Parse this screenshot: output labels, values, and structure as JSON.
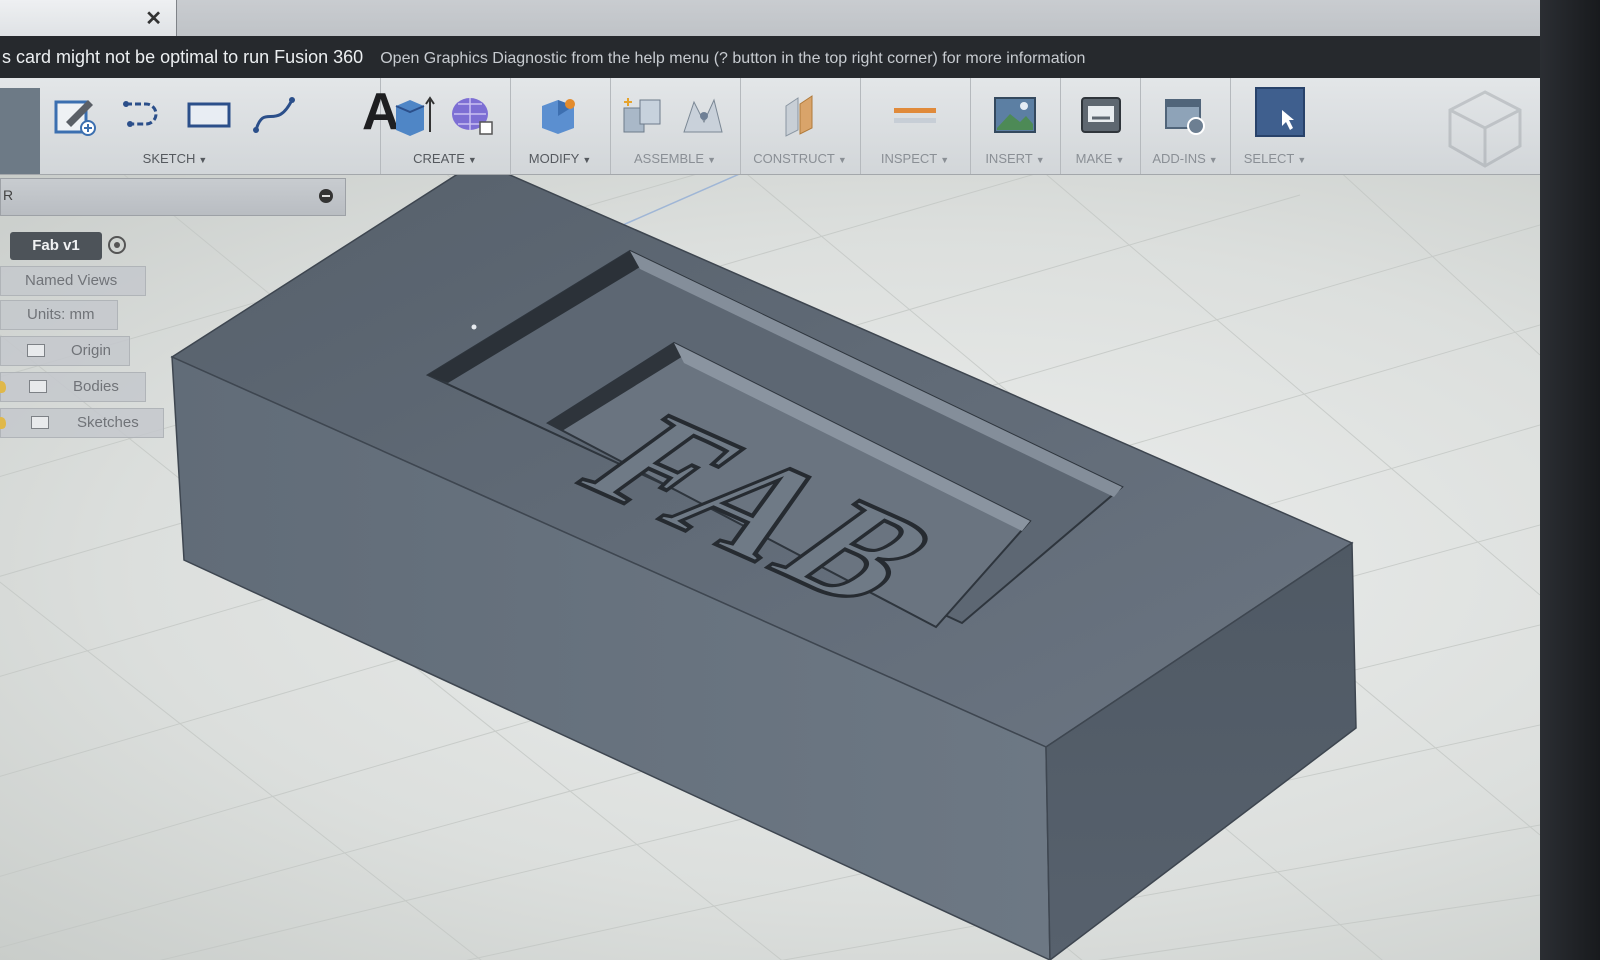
{
  "document_tab": {
    "close_glyph": "✕"
  },
  "warning": {
    "text": "s card might not be optimal to run Fusion 360",
    "link_text": "Open Graphics Diagnostic from the help menu (? button in the top right corner) for more information"
  },
  "toolbar": {
    "text_tool_glyph": "A",
    "groups": [
      {
        "label": "SKETCH",
        "caret": "▼"
      },
      {
        "label": "CREATE",
        "caret": "▼"
      },
      {
        "label": "MODIFY",
        "caret": "▼"
      },
      {
        "label": "ASSEMBLE",
        "caret": "▼"
      },
      {
        "label": "CONSTRUCT",
        "caret": "▼"
      },
      {
        "label": "INSPECT",
        "caret": "▼"
      },
      {
        "label": "INSERT",
        "caret": "▼"
      },
      {
        "label": "MAKE",
        "caret": "▼"
      },
      {
        "label": "ADD-INS",
        "caret": "▼"
      },
      {
        "label": "SELECT",
        "caret": "▼"
      }
    ]
  },
  "browser": {
    "header_letter": "R",
    "root": "Fab v1",
    "items": [
      {
        "label": "Named Views"
      },
      {
        "label": "Units: mm"
      },
      {
        "label": "Origin"
      },
      {
        "label": "Bodies"
      },
      {
        "label": "Sketches"
      }
    ]
  },
  "model": {
    "engraved_text": "FAB",
    "body_color": "#5a6470"
  }
}
